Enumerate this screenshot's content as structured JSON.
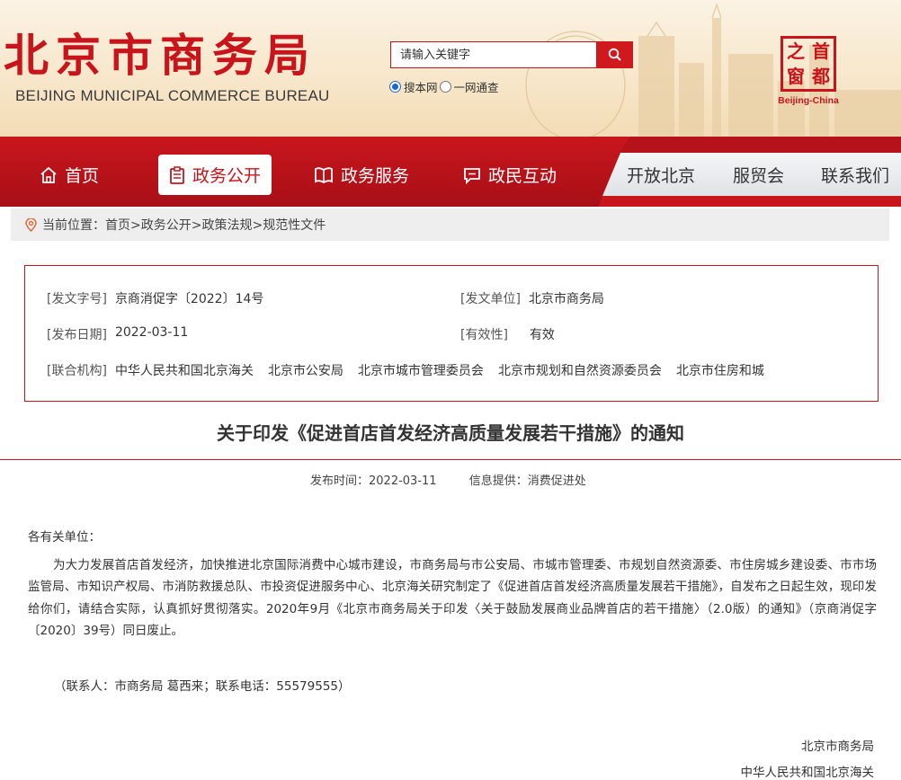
{
  "header": {
    "logo_cn": "北京市商务局",
    "logo_en": "BEIJING MUNICIPAL COMMERCE BUREAU",
    "search_placeholder": "请输入关键字",
    "scope_options": [
      "搜本网",
      "一网通查"
    ],
    "scope_selected": "搜本网",
    "seal_chars": [
      "之",
      "首",
      "窗",
      "都"
    ],
    "seal_en": "Beijing-China"
  },
  "nav": {
    "primary": [
      {
        "label": "首页",
        "icon": "home-icon"
      },
      {
        "label": "政务公开",
        "icon": "document-icon",
        "active": true
      },
      {
        "label": "政务服务",
        "icon": "book-icon"
      },
      {
        "label": "政民互动",
        "icon": "chat-icon"
      }
    ],
    "secondary": [
      "开放北京",
      "服贸会",
      "联系我们"
    ]
  },
  "breadcrumb": {
    "prefix": "当前位置：",
    "path": "首页>政务公开>政策法规>规范性文件"
  },
  "meta": {
    "doc_no_key": "[发文字号]",
    "doc_no": "京商消促字〔2022〕14号",
    "issuer_key": "[发文单位]",
    "issuer": "北京市商务局",
    "date_key": "[发布日期]",
    "date": "2022-03-11",
    "validity_key": "[有效性]",
    "validity": "有效",
    "joint_key": "[联合机构]",
    "joint_orgs": [
      "中华人民共和国北京海关",
      "北京市公安局",
      "北京市城市管理委员会",
      "北京市规划和自然资源委员会",
      "北京市住房和城"
    ]
  },
  "article": {
    "title": "关于印发《促进首店首发经济高质量发展若干措施》的通知",
    "publish_time": "发布时间：2022-03-11",
    "source": "信息提供：消费促进处",
    "salutation": "各有关单位：",
    "paragraph": "为大力发展首店首发经济，加快推进北京国际消费中心城市建设，市商务局与市公安局、市城市管理委、市规划自然资源委、市住房城乡建设委、市市场监管局、市知识产权局、市消防救援总队、市投资促进服务中心、北京海关研究制定了《促进首店首发经济高质量发展若干措施》，自发布之日起生效，现印发给你们，请结合实际，认真抓好贯彻落实。2020年9月《北京市商务局关于印发〈关于鼓励发展商业品牌首店的若干措施〉（2.0版）的通知》（京商消促字〔2020〕39号）同日废止。",
    "contact": "（联系人：市商务局 葛西来；联系电话：55579555）",
    "signature_1": "北京市商务局",
    "signature_2": "中华人民共和国北京海关"
  },
  "colors": {
    "brand_red": "#c8141a",
    "nav_red": "#b5121b",
    "header_bg": "#f7e6c9",
    "secondary_nav_bg": "#eceef1"
  }
}
